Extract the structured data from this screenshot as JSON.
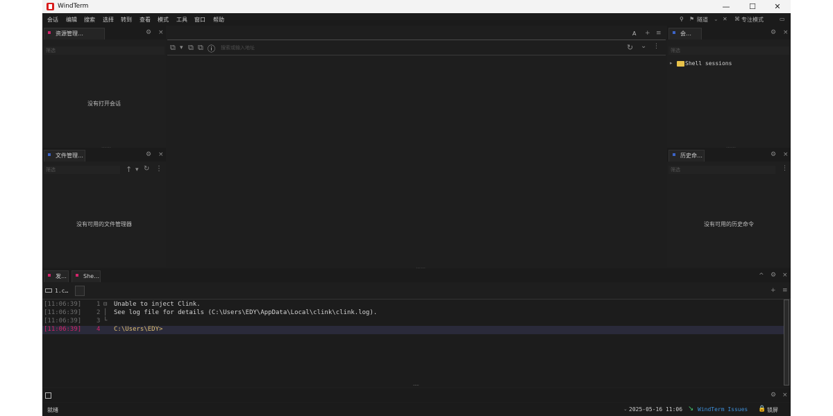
{
  "window": {
    "title": "WindTerm"
  },
  "window_controls": {
    "minimize": "—",
    "maximize": "☐",
    "close": "✕"
  },
  "menu": [
    "会话",
    "编辑",
    "搜索",
    "选择",
    "转到",
    "查看",
    "模式",
    "工具",
    "窗口",
    "帮助"
  ],
  "menubar_right": {
    "search_icon": "⚲",
    "tunnel_label": "隧道",
    "focus_label": "专注模式"
  },
  "explorer": {
    "tab_label": "资源管理…",
    "filter_placeholder": "筛选",
    "empty_message": "没有打开会话",
    "gear": "⚙",
    "close": "×"
  },
  "file_manager": {
    "tab_label": "文件管理…",
    "filter_placeholder": "筛选",
    "empty_message": "没有可用的文件管理器",
    "up": "↑",
    "down": "▾",
    "refresh": "↻",
    "more": "⋮",
    "gear": "⚙",
    "close": "×"
  },
  "editor": {
    "address_placeholder": "搜索或输入地址",
    "font_button": "A",
    "add_button": "+",
    "menu_button": "≡",
    "refresh": "↻",
    "dropdown": "⌄",
    "more": "⋮",
    "info": "ⓘ"
  },
  "sessions": {
    "tab_label": "会…",
    "filter_placeholder": "筛选",
    "tree": [
      {
        "label": "Shell sessions"
      }
    ],
    "gear": "⚙",
    "close": "×"
  },
  "history": {
    "tab_label": "历史命…",
    "filter_placeholder": "筛选",
    "empty_message": "没有可用的历史命令",
    "more": "⋮",
    "gear": "⚙",
    "close": "×"
  },
  "bottom_tabs": [
    {
      "label": "发…",
      "color": "#d3246b"
    },
    {
      "label": "She…",
      "color": "#d3246b"
    }
  ],
  "bottom_controls": {
    "collapse": "^",
    "gear": "⚙",
    "close": "×",
    "add": "+",
    "menu": "≡"
  },
  "terminal": {
    "session_tab": "1.c…",
    "lines": [
      {
        "time": "[11:06:39]",
        "num": "1",
        "gutter": "⊟",
        "text": "Unable to inject Clink."
      },
      {
        "time": "[11:06:39]",
        "num": "2",
        "gutter": "│",
        "text": "See log file for details (C:\\Users\\EDY\\AppData\\Local\\clink\\clink.log)."
      },
      {
        "time": "[11:06:39]",
        "num": "3",
        "gutter": "└",
        "text": ""
      },
      {
        "time": "[11:06:39]",
        "num": "4",
        "gutter": "",
        "text": "C:\\Users\\EDY>"
      }
    ]
  },
  "status": {
    "ready": "就绪",
    "datetime": "2025-05-16 11:06",
    "issues_link": "WindTerm Issues",
    "lock": "锁屏"
  },
  "colors": {
    "background": "#1e1e1e",
    "panel": "#1f1f1f",
    "accent_pink": "#d3246b",
    "accent_blue": "#3c64c8",
    "link_blue": "#3e8fd8",
    "folder_yellow": "#e8c24a",
    "prompt_line": "#2a2a3a"
  }
}
